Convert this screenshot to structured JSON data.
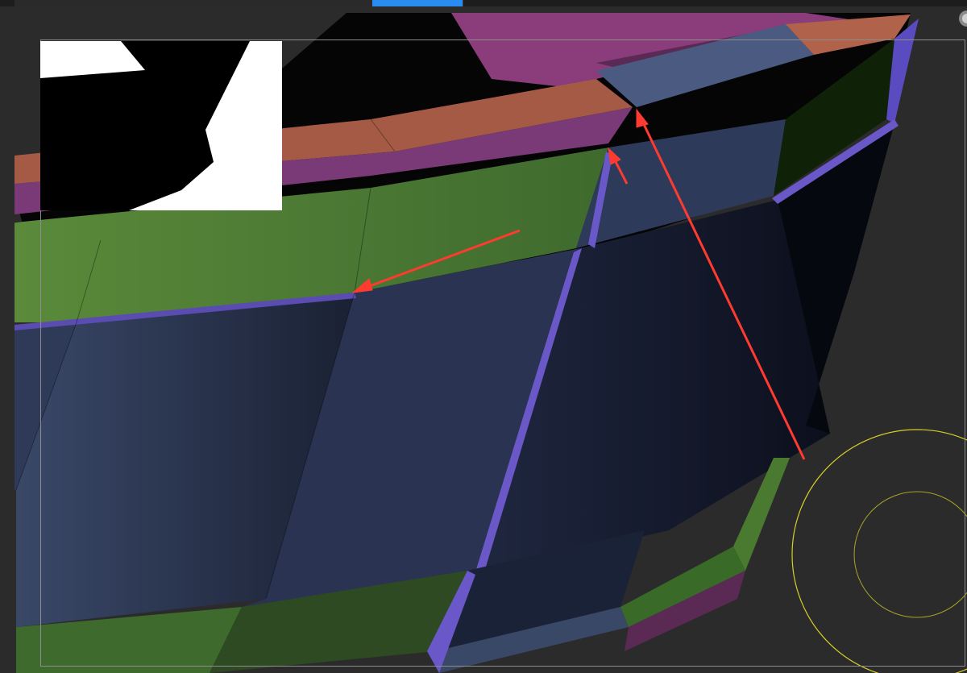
{
  "app": {
    "title": "",
    "top_tabs": [
      "",
      "",
      "",
      ""
    ],
    "active_tab_index": 4
  },
  "viewport": {
    "background": "#2b2b2b",
    "mesh_colors": {
      "blue_panel": "#34405c",
      "blue_panel_dark": "#1d2438",
      "green_band": "#4f7a35",
      "purple_band": "#7a3a78",
      "orange_rim": "#a45a45",
      "edge_highlight": "#6a58c8"
    },
    "annotation_color": "#ff3b30",
    "brush_ring_color": "#d6cf2a"
  },
  "left_rail": {
    "swatch_colors": [
      "#00ff66",
      "#00e5ff",
      "#e8c7a3",
      "#2a8cf0",
      "#2a8cf0"
    ]
  },
  "preview": {
    "label": ""
  }
}
